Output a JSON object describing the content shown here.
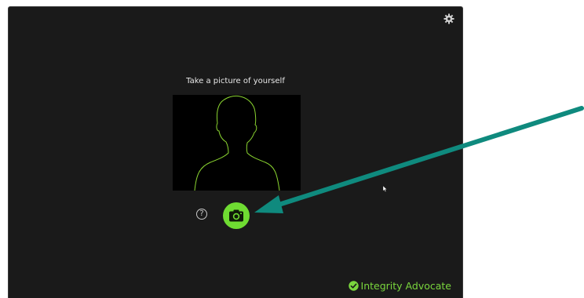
{
  "dialog": {
    "prompt": "Take a picture of yourself",
    "help_symbol": "?",
    "brand_name": "Integrity Advocate"
  },
  "icons": {
    "settings": "gear-icon",
    "help": "question-circle-icon",
    "capture": "camera-icon",
    "brand": "check-circle-icon",
    "annotation": "arrow-annotation"
  },
  "colors": {
    "panel_background": "#1a1a1a",
    "accent_green": "#6fdc32",
    "brand_green": "#7ad63d",
    "silhouette_outline": "#8ad430",
    "annotation_arrow": "#0f8a7e"
  }
}
